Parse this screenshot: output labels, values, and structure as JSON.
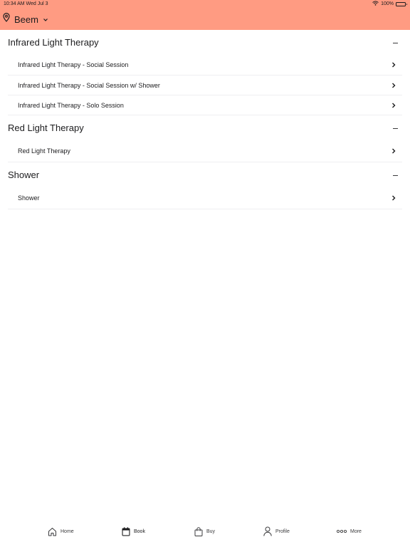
{
  "status_bar": {
    "time": "10:34 AM  Wed Jul 3",
    "battery_text": "100%",
    "battery_level": 1.0
  },
  "header": {
    "location": "Beem",
    "background": "#ff9b82"
  },
  "sections": [
    {
      "title": "Infrared Light Therapy",
      "items": [
        {
          "label": "Infrared Light Therapy - Social Session"
        },
        {
          "label": "Infrared Light Therapy - Social Session w/ Shower"
        },
        {
          "label": "Infrared Light Therapy - Solo Session"
        }
      ]
    },
    {
      "title": "Red Light Therapy",
      "items": [
        {
          "label": "Red Light Therapy"
        }
      ]
    },
    {
      "title": "Shower",
      "items": [
        {
          "label": "Shower"
        }
      ]
    }
  ],
  "tabbar": {
    "tabs": [
      {
        "label": "Home",
        "icon": "home-icon"
      },
      {
        "label": "Book",
        "icon": "calendar-icon",
        "selected": true
      },
      {
        "label": "Buy",
        "icon": "shopping-bag-icon"
      },
      {
        "label": "Profile",
        "icon": "person-icon"
      },
      {
        "label": "More",
        "icon": "more-dots-icon"
      }
    ]
  }
}
